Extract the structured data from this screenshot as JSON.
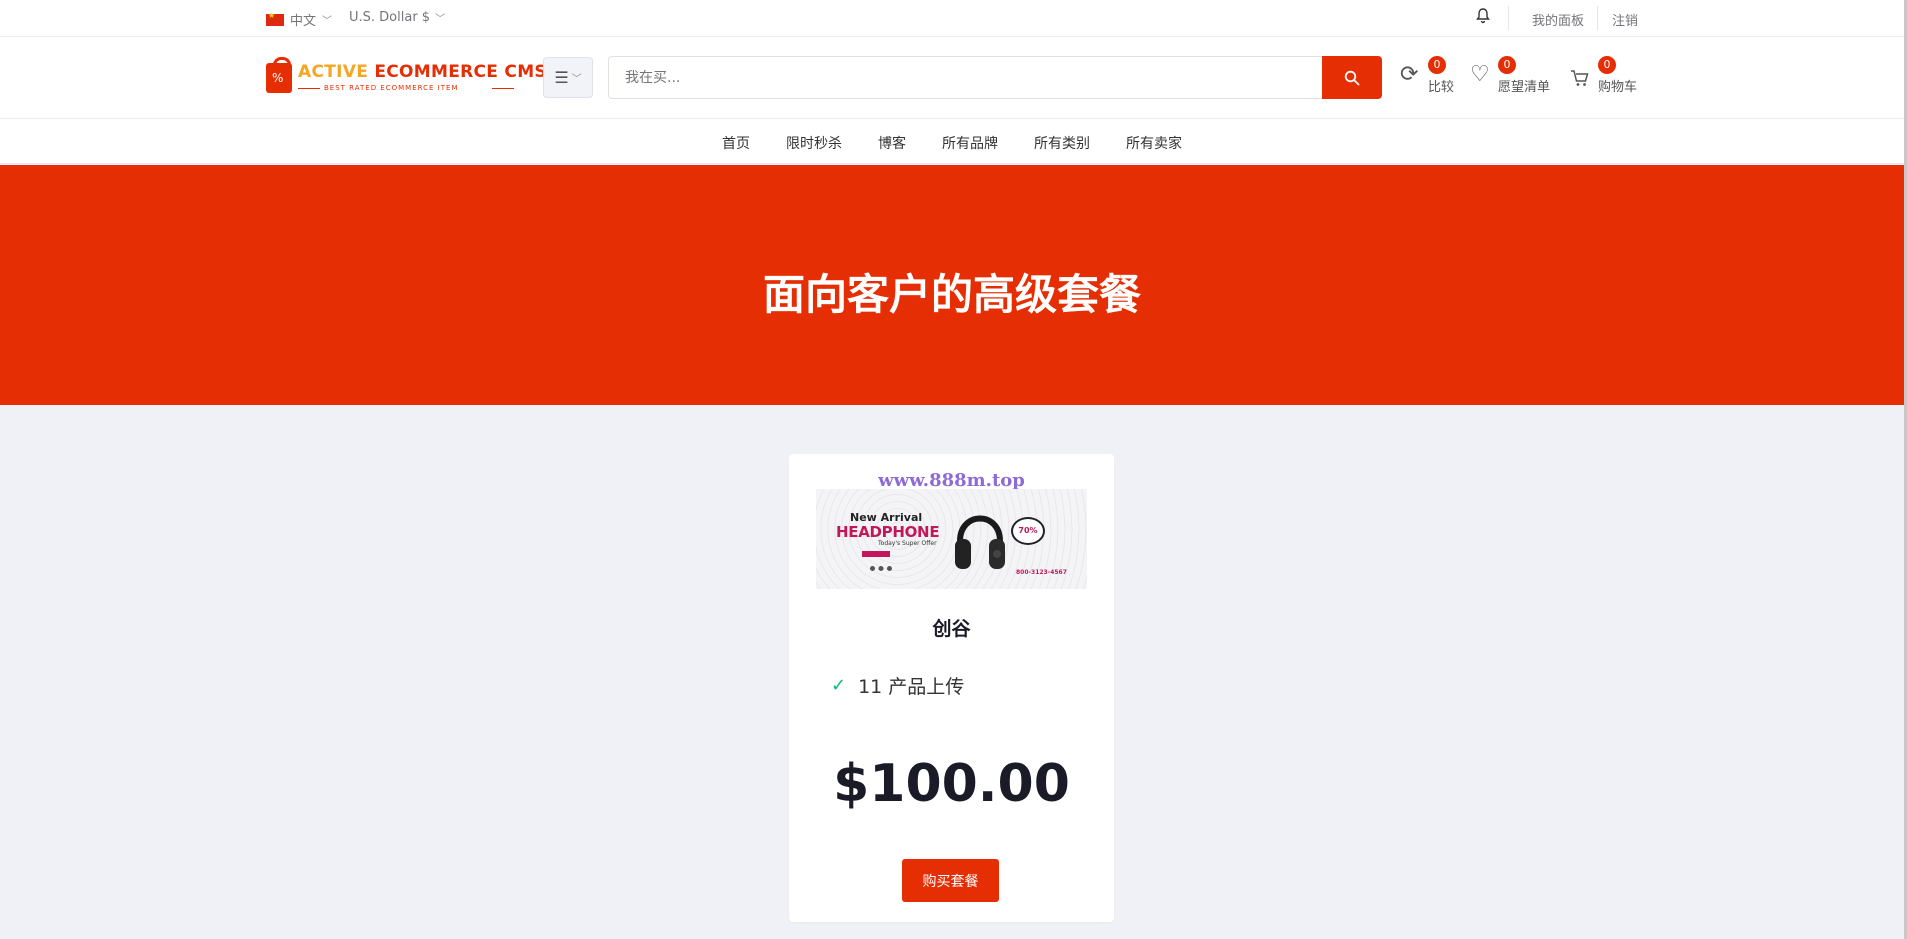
{
  "colors": {
    "accent": "#e62e04",
    "page_bg": "#f0f1f6",
    "check": "#0abb75"
  },
  "topbar": {
    "language": "中文",
    "currency": "U.S. Dollar $",
    "dashboard_link": "我的面板",
    "logout_link": "注销"
  },
  "header": {
    "logo_text_part1": "ACTIVE ",
    "logo_text_part2": "ECOMMERCE CMS",
    "logo_tagline": "BEST RATED ECOMMERCE ITEM",
    "search_placeholder": "我在买...",
    "compare": {
      "count": "0",
      "label": "比较"
    },
    "wishlist": {
      "count": "0",
      "label": "愿望清单"
    },
    "cart": {
      "count": "0",
      "label": "购物车"
    }
  },
  "nav": {
    "items": [
      "首页",
      "限时秒杀",
      "博客",
      "所有品牌",
      "所有类别",
      "所有卖家"
    ]
  },
  "hero": {
    "title": "面向客户的高级套餐"
  },
  "package": {
    "watermark": "www.888m.top",
    "banner": {
      "new_arrival": "New Arrival",
      "headphone": "HEADPHONE",
      "offer": "Today's Super Offer",
      "discount": "70%",
      "phone": "800-3123-4567"
    },
    "name": "创谷",
    "feature": "11 产品上传",
    "price": "$100.00",
    "buy_button": "购买套餐"
  }
}
